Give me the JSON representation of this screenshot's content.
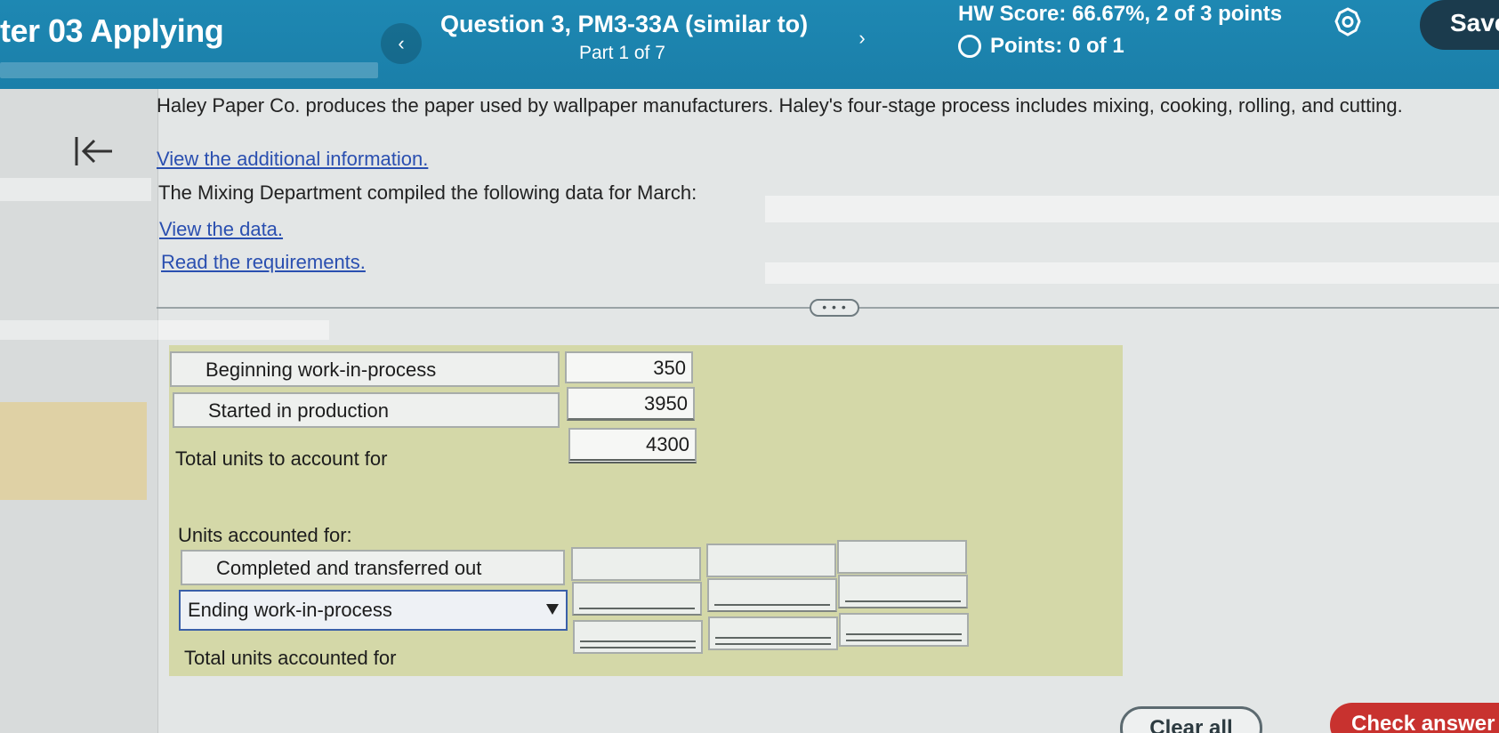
{
  "header": {
    "chapter_title": "ter 03 Applying",
    "question_title": "Question 3, PM3-33A (similar to)",
    "question_part": "Part 1 of 7",
    "hw_score": "HW Score: 66.67%, 2 of 3 points",
    "points": "Points: 0 of 1",
    "save_label": "Save",
    "prev_icon": "chevron-left-icon",
    "next_icon": "chevron-right-icon",
    "settings_icon": "gear-icon"
  },
  "content": {
    "intro": "Haley Paper Co. produces the paper used by wallpaper manufacturers. Haley's four-stage process includes mixing, cooking, rolling, and cutting.",
    "additional_info_link": "View the additional information.",
    "mixing_line": "The Mixing Department compiled the following data for March:",
    "data_link": "View the data.",
    "requirements_link": "Read the requirements.",
    "expand_dots": "• • •"
  },
  "worksheet": {
    "rows": [
      {
        "label": "Beginning work-in-process",
        "value": "350"
      },
      {
        "label": "Started in production",
        "value": "3950"
      }
    ],
    "total_to_account_label": "Total units to account for",
    "total_to_account_value": "4300",
    "accounted_header": "Units accounted for:",
    "completed_label": "Completed and transferred out",
    "ending_select_value": "Ending work-in-process",
    "total_accounted_label": "Total units accounted for"
  },
  "footer": {
    "clear_all": "Clear all",
    "check_answer": "Check answer"
  },
  "colors": {
    "header_blue": "#1a7ea8",
    "link_blue": "#2a4fb0",
    "worksheet_bg": "#d4d8a8",
    "check_red": "#c8322f",
    "save_dark": "#1b3b4d"
  }
}
